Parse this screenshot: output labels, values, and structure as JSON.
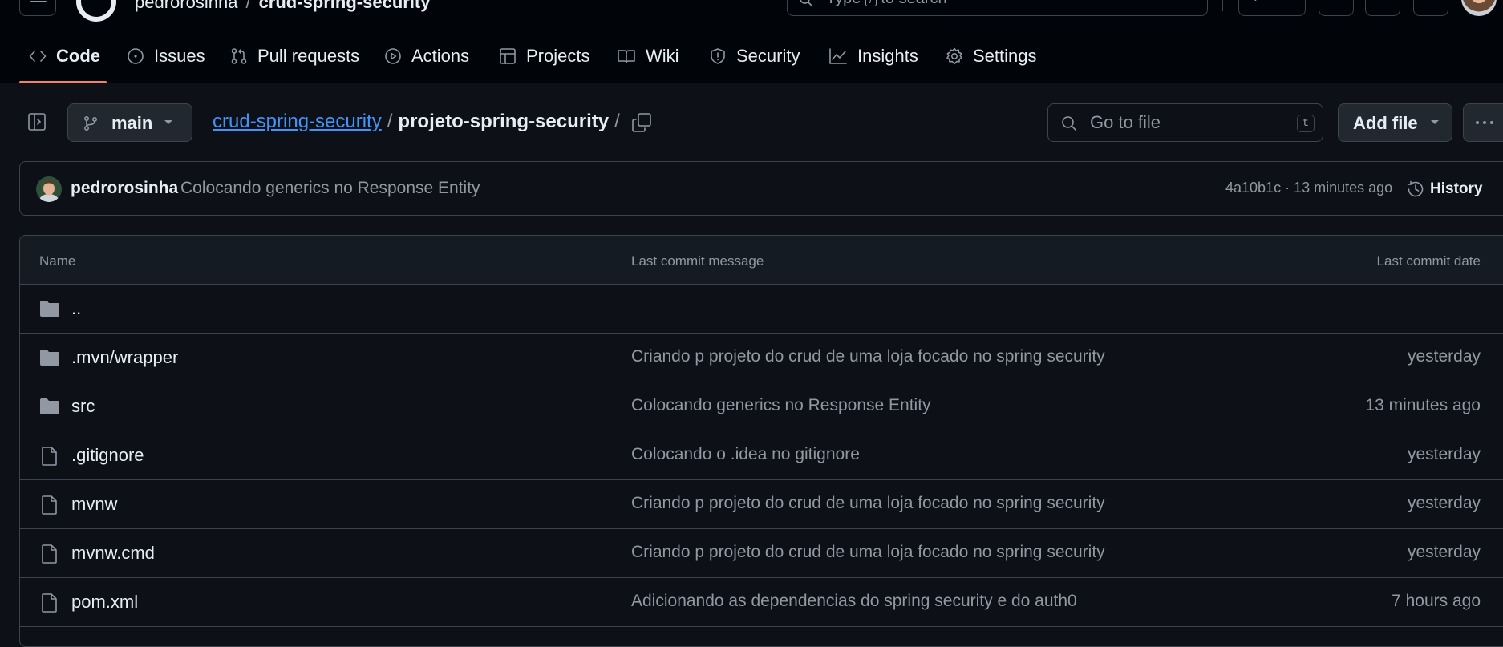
{
  "header": {
    "owner": "pedrorosinha",
    "separator": "/",
    "repo": "crud-spring-security",
    "search": {
      "before_key": "Type",
      "key": "/",
      "after_key": "to search"
    },
    "create_label": "+"
  },
  "tabs": [
    {
      "label": "Code",
      "icon": "code-icon"
    },
    {
      "label": "Issues",
      "icon": "issue-opened-icon"
    },
    {
      "label": "Pull requests",
      "icon": "git-pull-request-icon"
    },
    {
      "label": "Actions",
      "icon": "play-icon"
    },
    {
      "label": "Projects",
      "icon": "table-icon"
    },
    {
      "label": "Wiki",
      "icon": "book-icon"
    },
    {
      "label": "Security",
      "icon": "shield-icon"
    },
    {
      "label": "Insights",
      "icon": "graph-icon"
    },
    {
      "label": "Settings",
      "icon": "gear-icon"
    }
  ],
  "filenav": {
    "branch": "main",
    "breadcrumb": {
      "repo": "crud-spring-security",
      "separator": "/",
      "folder": "projeto-spring-security",
      "trailing": "/"
    },
    "goto_placeholder": "Go to file",
    "goto_shortcut": "t",
    "add_file_label": "Add file"
  },
  "commit": {
    "author": "pedrorosinha",
    "message": "Colocando generics no Response Entity",
    "meta": "4a10b1c · 13 minutes ago",
    "history_label": "History"
  },
  "table": {
    "headers": {
      "name": "Name",
      "message": "Last commit message",
      "date": "Last commit date"
    },
    "rows": [
      {
        "name": "..",
        "type": "folder",
        "message": "",
        "date": ""
      },
      {
        "name": ".mvn/wrapper",
        "type": "folder",
        "message": "Criando p projeto do crud de uma loja focado no spring security",
        "date": "yesterday"
      },
      {
        "name": "src",
        "type": "folder",
        "message": "Colocando generics no Response Entity",
        "date": "13 minutes ago"
      },
      {
        "name": ".gitignore",
        "type": "file",
        "message": "Colocando o .idea no gitignore",
        "date": "yesterday"
      },
      {
        "name": "mvnw",
        "type": "file",
        "message": "Criando p projeto do crud de uma loja focado no spring security",
        "date": "yesterday"
      },
      {
        "name": "mvnw.cmd",
        "type": "file",
        "message": "Criando p projeto do crud de uma loja focado no spring security",
        "date": "yesterday"
      },
      {
        "name": "pom.xml",
        "type": "file",
        "message": "Adicionando as dependencias do spring security e do auth0",
        "date": "7 hours ago"
      }
    ]
  },
  "colors": {
    "background": "#0d1117",
    "header": "#010409",
    "border": "#3d444d",
    "accent_underline": "#f78166",
    "link": "#4493f8",
    "muted": "#9198a1"
  }
}
